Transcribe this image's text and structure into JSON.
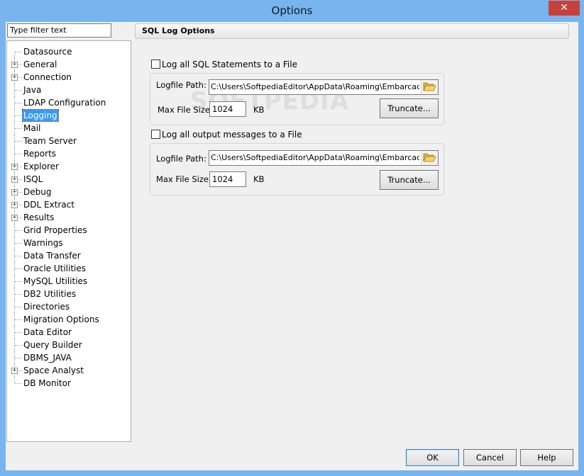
{
  "window": {
    "title": "Options",
    "close_glyph": "✕"
  },
  "filter": {
    "value": "Type filter text"
  },
  "tree": [
    {
      "label": "Datasource",
      "expandable": false
    },
    {
      "label": "General",
      "expandable": true
    },
    {
      "label": "Connection",
      "expandable": true
    },
    {
      "label": "Java",
      "expandable": false
    },
    {
      "label": "LDAP Configuration",
      "expandable": false
    },
    {
      "label": "Logging",
      "expandable": false,
      "selected": true
    },
    {
      "label": "Mail",
      "expandable": false
    },
    {
      "label": "Team Server",
      "expandable": false
    },
    {
      "label": "Reports",
      "expandable": false
    },
    {
      "label": "Explorer",
      "expandable": true
    },
    {
      "label": "ISQL",
      "expandable": true
    },
    {
      "label": "Debug",
      "expandable": true
    },
    {
      "label": "DDL Extract",
      "expandable": true
    },
    {
      "label": "Results",
      "expandable": true
    },
    {
      "label": "Grid Properties",
      "expandable": false
    },
    {
      "label": "Warnings",
      "expandable": false
    },
    {
      "label": "Data Transfer",
      "expandable": false
    },
    {
      "label": "Oracle Utilities",
      "expandable": false
    },
    {
      "label": "MySQL Utilities",
      "expandable": false
    },
    {
      "label": "DB2 Utilities",
      "expandable": false
    },
    {
      "label": "Directories",
      "expandable": false
    },
    {
      "label": "Migration Options",
      "expandable": false
    },
    {
      "label": "Data Editor",
      "expandable": false
    },
    {
      "label": "Query Builder",
      "expandable": false
    },
    {
      "label": "DBMS_JAVA",
      "expandable": false
    },
    {
      "label": "Space Analyst",
      "expandable": true
    },
    {
      "label": "DB Monitor",
      "expandable": false
    }
  ],
  "panel": {
    "header": "SQL Log Options",
    "sql": {
      "checkbox_label": "Log all SQL Statements to a File",
      "logfile_label": "Logfile Path:",
      "logfile_path": "C:\\Users\\SoftpediaEditor\\AppData\\Roaming\\Embarcadero\\D",
      "maxsize_label": "Max File Size:",
      "maxsize_value": "1024",
      "unit": "KB",
      "truncate_label": "Truncate..."
    },
    "output": {
      "checkbox_label": "Log all output messages to a File",
      "logfile_label": "Logfile Path:",
      "logfile_path": "C:\\Users\\SoftpediaEditor\\AppData\\Roaming\\Embarcadero\\D",
      "maxsize_label": "Max File Size:",
      "maxsize_value": "1024",
      "unit": "KB",
      "truncate_label": "Truncate..."
    }
  },
  "buttons": {
    "ok": "OK",
    "cancel": "Cancel",
    "help": "Help"
  },
  "watermark": "SOFTPEDIA",
  "colors": {
    "title_bar": "#78b4ee",
    "close_button": "#c7403a",
    "selection": "#3399ff"
  }
}
